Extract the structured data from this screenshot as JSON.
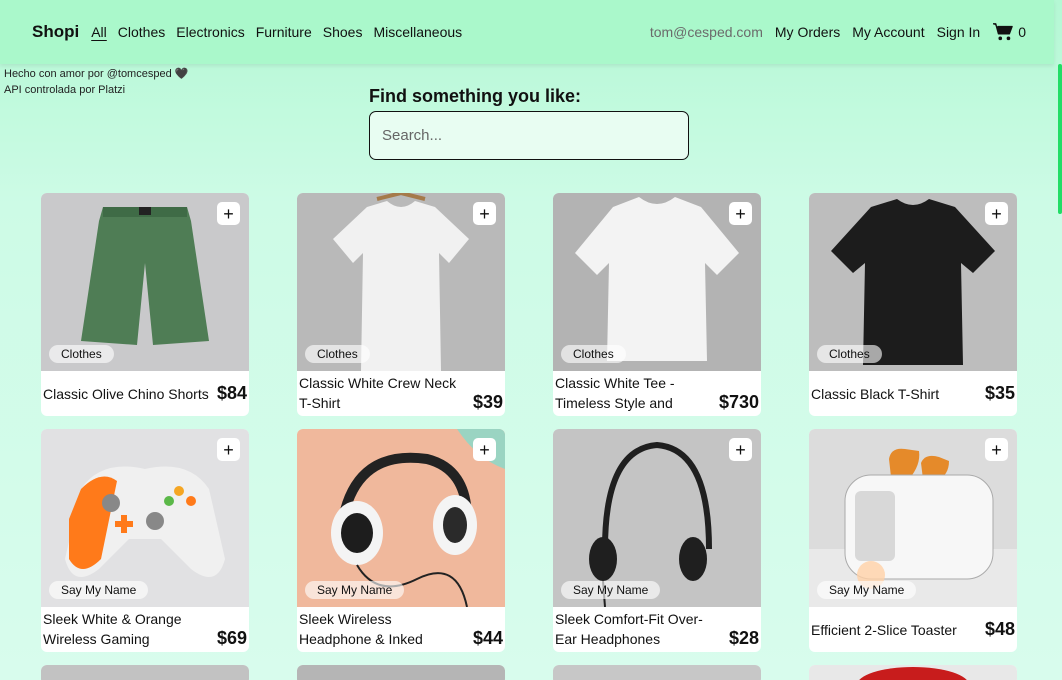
{
  "nav": {
    "brand": "Shopi",
    "categories": [
      "All",
      "Clothes",
      "Electronics",
      "Furniture",
      "Shoes",
      "Miscellaneous"
    ],
    "email": "tom@cesped.com",
    "my_orders": "My Orders",
    "my_account": "My Account",
    "sign_in": "Sign In",
    "cart_count": "0",
    "cart_icon": "shopping-cart-icon"
  },
  "credits": {
    "line1": "Hecho con amor por @tomcesped 🖤",
    "line2": "API controlada por Platzi"
  },
  "search": {
    "title": "Find something you like:",
    "placeholder": "Search..."
  },
  "products": [
    {
      "title": "Classic Olive Chino Shorts",
      "price": "$84",
      "category": "Clothes",
      "image": "olive-shorts"
    },
    {
      "title": "Classic White Crew Neck T-Shirt",
      "price": "$39",
      "category": "Clothes",
      "image": "white-tshirt-hanger"
    },
    {
      "title": "Classic White Tee - Timeless Style and",
      "price": "$730",
      "category": "Clothes",
      "image": "white-tee"
    },
    {
      "title": "Classic Black T-Shirt",
      "price": "$35",
      "category": "Clothes",
      "image": "black-tshirt"
    },
    {
      "title": "Sleek White & Orange Wireless Gaming",
      "price": "$69",
      "category": "Say My Name",
      "image": "game-controller"
    },
    {
      "title": "Sleek Wireless Headphone & Inked",
      "price": "$44",
      "category": "Say My Name",
      "image": "white-headphones"
    },
    {
      "title": "Sleek Comfort-Fit Over-Ear Headphones",
      "price": "$28",
      "category": "Say My Name",
      "image": "black-headphones"
    },
    {
      "title": "Efficient 2-Slice Toaster",
      "price": "$48",
      "category": "Say My Name",
      "image": "toaster"
    }
  ],
  "colors": {
    "navbar": "#aaf8cb",
    "background": "#cdfbe6",
    "accent_scrollbar": "#22dd66"
  }
}
